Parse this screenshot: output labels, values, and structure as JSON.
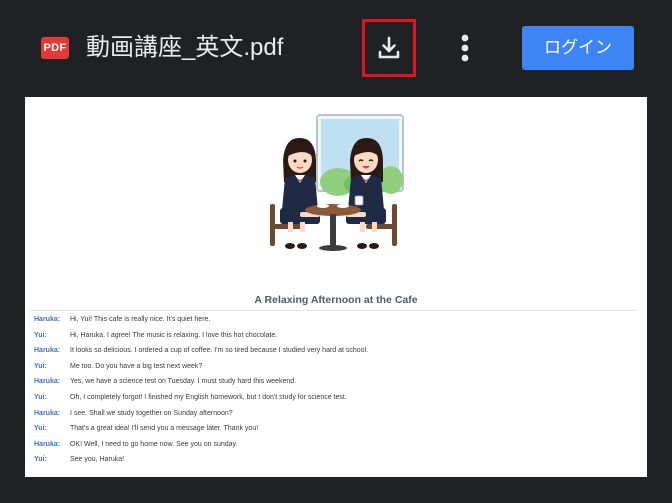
{
  "toolbar": {
    "file_icon": "pdf-file-icon",
    "file_badge": "PDF",
    "file_name": "動画講座_英文.pdf",
    "download_icon": "download-icon",
    "more_icon": "more-vertical-icon",
    "login_label": "ログイン",
    "login_color": "#3d85f5",
    "highlight_color": "#e5131b"
  },
  "document": {
    "illustration_icon": "two-students-at-cafe-table-illustration",
    "heading": "A Relaxing Afternoon at the Cafe",
    "lines": [
      {
        "speaker": "Haruka:",
        "text": "Hi, Yui! This cafe is really nice. It's quiet here."
      },
      {
        "speaker": "Yui:",
        "text": "Hi, Haruka. I agree! The music is relaxing. I love this hot chocolate."
      },
      {
        "speaker": "Haruka:",
        "text": "It looks so delicious. I ordered a cup of coffee. I'm so tired because I studied very hard at school."
      },
      {
        "speaker": "Yui:",
        "text": "Me too. Do you have a big test next week?"
      },
      {
        "speaker": "Haruka:",
        "text": "Yes, we have a science test on Tuesday. I must study hard this weekend."
      },
      {
        "speaker": "Yui:",
        "text": "Oh, I completely forgot! I finished my English homework, but I don't study for science test."
      },
      {
        "speaker": "Haruka:",
        "text": "I see. Shall we study together on Sunday afternoon?"
      },
      {
        "speaker": "Yui:",
        "text": "That's a great idea! I'll send you a message later. Thank you!"
      },
      {
        "speaker": "Haruka:",
        "text": "OK! Well, I need to go home now. See you on sunday."
      },
      {
        "speaker": "Yui:",
        "text": "See you, Haruka!"
      }
    ]
  }
}
